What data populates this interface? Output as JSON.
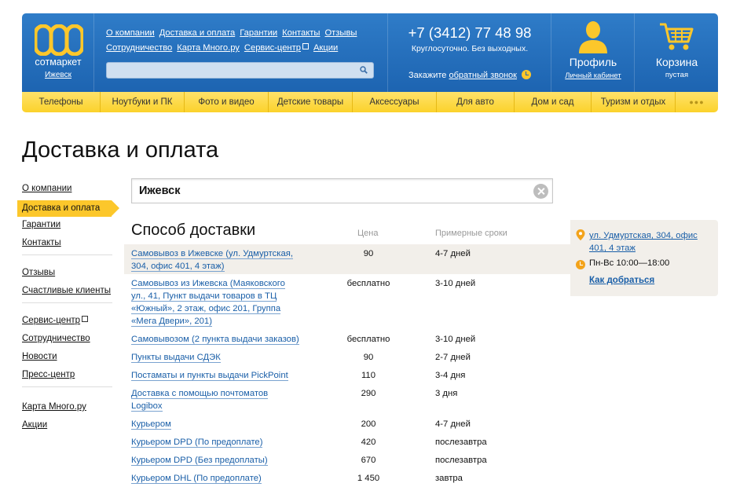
{
  "brand": {
    "name": "сотмаркет",
    "city": "Ижевск",
    "accent": "#fcc72b",
    "header_blue": "#1d64b1"
  },
  "top_links": [
    "О компании",
    "Доставка и оплата",
    "Гарантии",
    "Контакты",
    "Отзывы",
    "Сотрудничество",
    "Карта Много.ру",
    "Сервис-центр",
    "Акции"
  ],
  "search": {
    "placeholder": "",
    "icon": "search-icon"
  },
  "contact": {
    "phone": "+7 (3412) 77 48 98",
    "hours": "Круглосуточно. Без выходных.",
    "callback_prefix": "Закажите",
    "callback_link": "обратный звонок"
  },
  "profile": {
    "title": "Профиль",
    "subtitle": "Личный кабинет"
  },
  "cart": {
    "title": "Корзина",
    "subtitle": "пустая"
  },
  "categories": [
    "Телефоны",
    "Ноутбуки и ПК",
    "Фото и видео",
    "Детские товары",
    "Аксессуары",
    "Для авто",
    "Дом и сад",
    "Туризм и отдых"
  ],
  "page": {
    "title": "Доставка и оплата"
  },
  "leftnav": {
    "group1": [
      "О компании",
      "Доставка и оплата",
      "Гарантии",
      "Контакты"
    ],
    "group2": [
      "Отзывы",
      "Счастливые клиенты"
    ],
    "group3": [
      "Сервис-центр",
      "Сотрудничество",
      "Новости",
      "Пресс-центр"
    ],
    "group4": [
      "Карта Много.ру",
      "Акции"
    ],
    "active": "Доставка и оплата"
  },
  "city_selector": {
    "value": "Ижевск"
  },
  "delivery": {
    "heading": "Способ доставки",
    "col_price": "Цена",
    "col_terms": "Примерные сроки",
    "rows": [
      {
        "method": "Самовывоз в Ижевске (ул. Удмуртская, 304, офис 401, 4 этаж)",
        "price": "90",
        "terms": "4-7 дней"
      },
      {
        "method": "Самовывоз из Ижевска (Маяковского ул., 41, Пункт выдачи товаров в ТЦ «Южный», 2 этаж, офис 201, Группа «Мега Двери», 201)",
        "price": "бесплатно",
        "terms": "3-10 дней"
      },
      {
        "method": "Самовывозом (2 пункта выдачи заказов)",
        "price": "бесплатно",
        "terms": "3-10 дней"
      },
      {
        "method": "Пункты выдачи СДЭК",
        "price": "90",
        "terms": "2-7 дней"
      },
      {
        "method": "Постаматы и пункты выдачи PickPoint",
        "price": "110",
        "terms": "3-4 дня"
      },
      {
        "method": "Доставка с помощью почтоматов Logibox",
        "price": "290",
        "terms": "3 дня"
      },
      {
        "method": "Курьером",
        "price": "200",
        "terms": "4-7 дней"
      },
      {
        "method": "Курьером DPD (По предоплате)",
        "price": "420",
        "terms": "послезавтра"
      },
      {
        "method": "Курьером DPD (Без предоплаты)",
        "price": "670",
        "terms": "послезавтра"
      },
      {
        "method": "Курьером DHL (По предоплате)",
        "price": "1 450",
        "terms": "завтра"
      }
    ]
  },
  "pickup": {
    "address": "ул. Удмуртская, 304, офис 401, 4 этаж",
    "hours": "Пн-Вс  10:00—18:00",
    "route_link": "Как добраться"
  }
}
